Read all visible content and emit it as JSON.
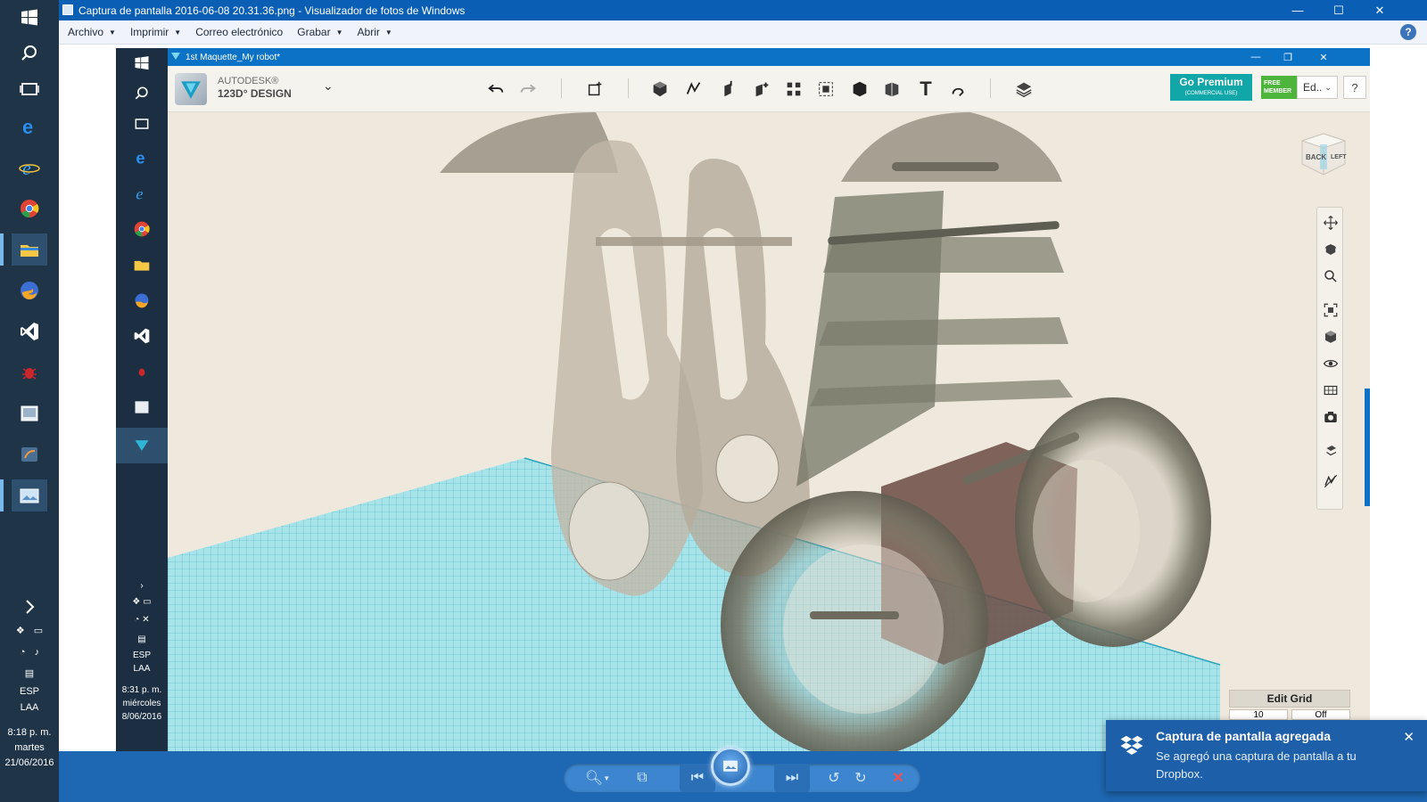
{
  "viewer": {
    "title": "Captura de pantalla 2016-06-08 20.31.36.png - Visualizador de fotos de Windows",
    "menu": [
      "Archivo",
      "Imprimir",
      "Correo electrónico",
      "Grabar",
      "Abrir"
    ],
    "controls": {
      "minimize": "—",
      "maximize": "☐",
      "close": "✕",
      "help": "?"
    }
  },
  "outer_taskbar": {
    "icons": [
      "windows-start-icon",
      "search-icon",
      "task-view-icon",
      "edge-icon",
      "internet-explorer-icon",
      "chrome-icon",
      "file-explorer-icon",
      "firefox-developer-icon",
      "visual-studio-icon",
      "bug-app-icon",
      "photos-app-icon",
      "sublime-like-app-icon",
      "photo-viewer-icon"
    ],
    "tray": {
      "lang": "ESP",
      "layout": "LAA",
      "time": "8:18 p. m.",
      "day": "martes",
      "date": "21/06/2016"
    }
  },
  "inner_taskbar": {
    "tray": {
      "lang": "ESP",
      "layout": "LAA",
      "time": "8:31 p. m.",
      "day": "miércoles",
      "date": "8/06/2016"
    }
  },
  "app": {
    "window_title": "1st Maquette_My robot*",
    "brand_line1": "AUTODESK®",
    "brand_line2": "123D° DESIGN",
    "premium_label": "Go Premium",
    "premium_sub": "(COMMERCIAL USE)",
    "free_badge_line1": "FREE",
    "free_badge_line2": "MEMBER",
    "account_label": "Ed..",
    "help_label": "?",
    "viewcube_back": "BACK",
    "viewcube_left": "LEFT",
    "edit_grid_label": "Edit Grid",
    "grid_value_1": "10",
    "grid_value_2": "Off"
  },
  "toast": {
    "title": "Captura de pantalla agregada",
    "body": "Se agregó una captura de pantalla a tu Dropbox."
  },
  "colors": {
    "titlebar": "#0a5fb4",
    "app_accent": "#0b72c6",
    "grid": "#49c3d2",
    "premium": "#11a6a7"
  }
}
